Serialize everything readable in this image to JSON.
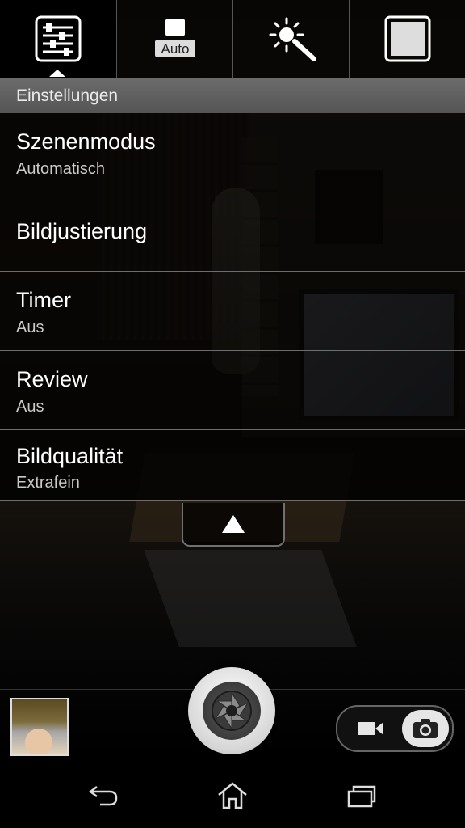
{
  "toolbar": {
    "buttons": [
      {
        "icon": "settings-sliders-icon",
        "active": true
      },
      {
        "icon": "auto-scene-icon",
        "label": "Auto"
      },
      {
        "icon": "brightness-wand-icon"
      },
      {
        "icon": "square-frame-icon"
      }
    ]
  },
  "settings": {
    "header": "Einstellungen",
    "items": [
      {
        "title": "Szenenmodus",
        "value": "Automatisch"
      },
      {
        "title": "Bildjustierung",
        "value": ""
      },
      {
        "title": "Timer",
        "value": "Aus"
      },
      {
        "title": "Review",
        "value": "Aus"
      },
      {
        "title": "Bildqualität",
        "value": "Extrafein"
      }
    ]
  },
  "controls": {
    "mode_selected": "photo",
    "modes": [
      "video",
      "photo"
    ]
  },
  "colors": {
    "header_bg": "#5e5e5e",
    "menu_bg": "#000000",
    "divider": "#6d6d6d"
  }
}
